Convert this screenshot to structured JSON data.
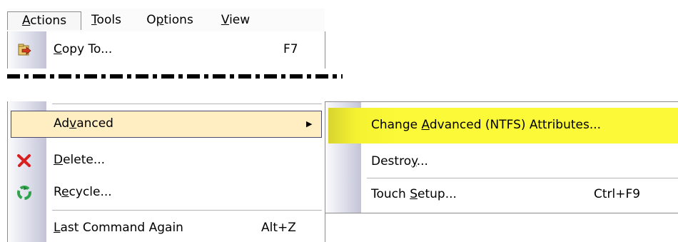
{
  "menubar": {
    "items": [
      {
        "pre": "",
        "u": "A",
        "post": "ctions"
      },
      {
        "pre": "",
        "u": "T",
        "post": "ools"
      },
      {
        "pre": "O",
        "u": "p",
        "post": "tions"
      },
      {
        "pre": "",
        "u": "V",
        "post": "iew"
      }
    ]
  },
  "menu_top": {
    "copy_to": {
      "pre": "",
      "u": "C",
      "post": "opy To...",
      "shortcut": "F7",
      "icon": "copy-to-icon"
    }
  },
  "menu_bottom": {
    "advanced": {
      "pre": "Ad",
      "u": "v",
      "post": "anced",
      "arrow": "▶"
    },
    "delete": {
      "pre": "",
      "u": "D",
      "post": "elete...",
      "icon": "delete-x-icon"
    },
    "recycle": {
      "pre": "R",
      "u": "e",
      "post": "cycle...",
      "icon": "recycle-icon"
    },
    "last_command": {
      "pre": "",
      "u": "L",
      "post": "ast Command Again",
      "shortcut": "Alt+Z"
    }
  },
  "submenu": {
    "change_attrs": {
      "pre": "Change ",
      "u": "A",
      "post": "dvanced (NTFS) Attributes..."
    },
    "destroy": {
      "pre": "Destro",
      "u": "y",
      "post": "..."
    },
    "touch_setup": {
      "pre": "Touch ",
      "u": "S",
      "post": "etup...",
      "shortcut": "Ctrl+F9"
    }
  },
  "colors": {
    "highlight": "#ffeec2",
    "submenu_highlight": "#fcfa38",
    "border": "#8c8c8c"
  }
}
